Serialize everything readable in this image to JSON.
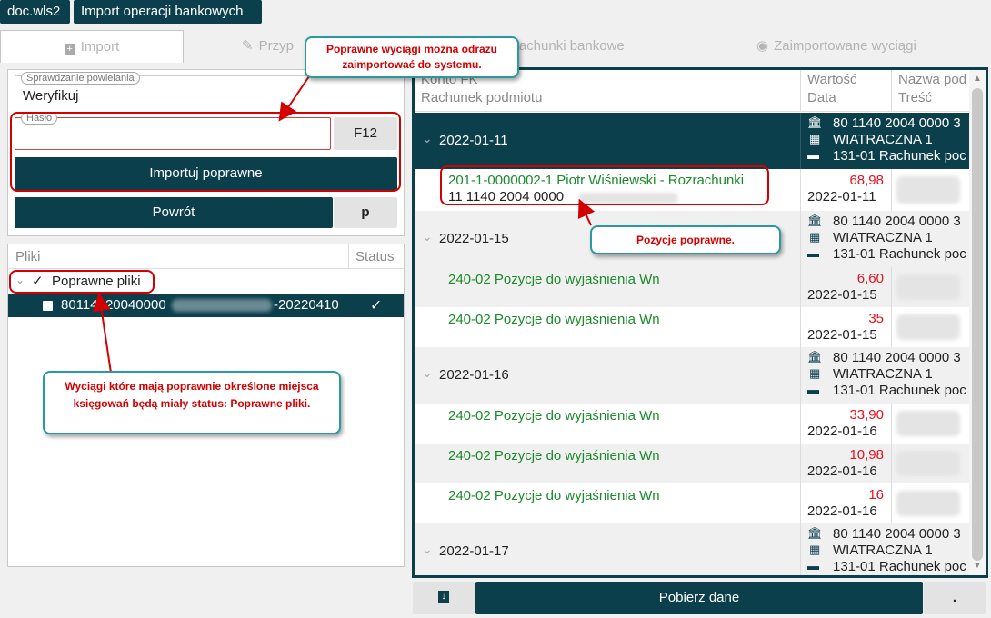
{
  "top_buttons": {
    "doc": "doc.wls2",
    "title": "Import operacji bankowych"
  },
  "tabs": [
    {
      "label": "Import"
    },
    {
      "label": "Przyp"
    },
    {
      "label": "Rachunki bankowe"
    },
    {
      "label": "Zaimportowane wyciągi"
    }
  ],
  "left": {
    "dup_check_label": "Sprawdzanie powielania",
    "dup_check_value": "Weryfikuj",
    "password_label": "Hasło",
    "password_value": "",
    "f12_label": "F12",
    "import_button": "Importuj poprawne",
    "back_button": "Powrót",
    "back_shortcut": "p"
  },
  "tree": {
    "col_files": "Pliki",
    "col_status": "Status",
    "group_label": "Poprawne pliki",
    "file_name_start": "80114020040000",
    "file_name_end": "-20220410",
    "status_icon": "check-icon"
  },
  "grid": {
    "headers": {
      "col1_line1": "Konto FK",
      "col1_line2": "Rachunek podmiotu",
      "col2_line1": "Wartość",
      "col2_line2": "Data",
      "col3_line1": "Nazwa pod",
      "col3_line2": "Treść"
    },
    "groups": [
      {
        "date": "2022-01-11",
        "account": "80 1140 2004 0000 3",
        "name": "WIATRACZNA 1",
        "ledger": "131-01 Rachunek poc",
        "style": "dark"
      },
      {
        "date": "2022-01-15",
        "account": "80 1140 2004 0000 3",
        "name": "WIATRACZNA 1",
        "ledger": "131-01 Rachunek poc",
        "style": "light"
      },
      {
        "date": "2022-01-16",
        "account": "80 1140 2004 0000 3",
        "name": "WIATRACZNA 1",
        "ledger": "131-01 Rachunek poc",
        "style": "light"
      },
      {
        "date": "2022-01-17",
        "account": "80 1140 2004 0000 3",
        "name": "WIATRACZNA 1",
        "ledger": "131-01 Rachunek poc",
        "style": "light"
      }
    ],
    "rows": [
      {
        "account": "201-1-0000002-1 Piotr Wiśniewski - Rozrachunki",
        "subaccount": "11 1140 2004 0000",
        "value": "68,98",
        "date": "2022-01-11"
      },
      {
        "account": "240-02 Pozycje do wyjaśnienia Wn",
        "value": "6,60",
        "date": "2022-01-15"
      },
      {
        "account": "240-02 Pozycje do wyjaśnienia Wn",
        "value": "35",
        "date": "2022-01-15"
      },
      {
        "account": "240-02 Pozycje do wyjaśnienia Wn",
        "value": "33,90",
        "date": "2022-01-16"
      },
      {
        "account": "240-02 Pozycje do wyjaśnienia Wn",
        "value": "10,98",
        "date": "2022-01-16"
      },
      {
        "account": "240-02 Pozycje do wyjaśnienia Wn",
        "value": "16",
        "date": "2022-01-16"
      }
    ]
  },
  "bottom": {
    "fetch_button": "Pobierz dane",
    "dot_button": "."
  },
  "callouts": {
    "top": "Poprawne wyciągi można odrazu zaimportować do systemu.",
    "positions": "Pozycje poprawne.",
    "files": "Wyciągi które mają poprawnie określone miejsca księgowań będą miały status: Poprawne pliki."
  },
  "colors": {
    "dark": "#0b3f4c",
    "accent_red": "#d40000",
    "callout_border": "#2a9a9e",
    "green_text": "#1a8a2a",
    "value_red": "#e0141e"
  }
}
